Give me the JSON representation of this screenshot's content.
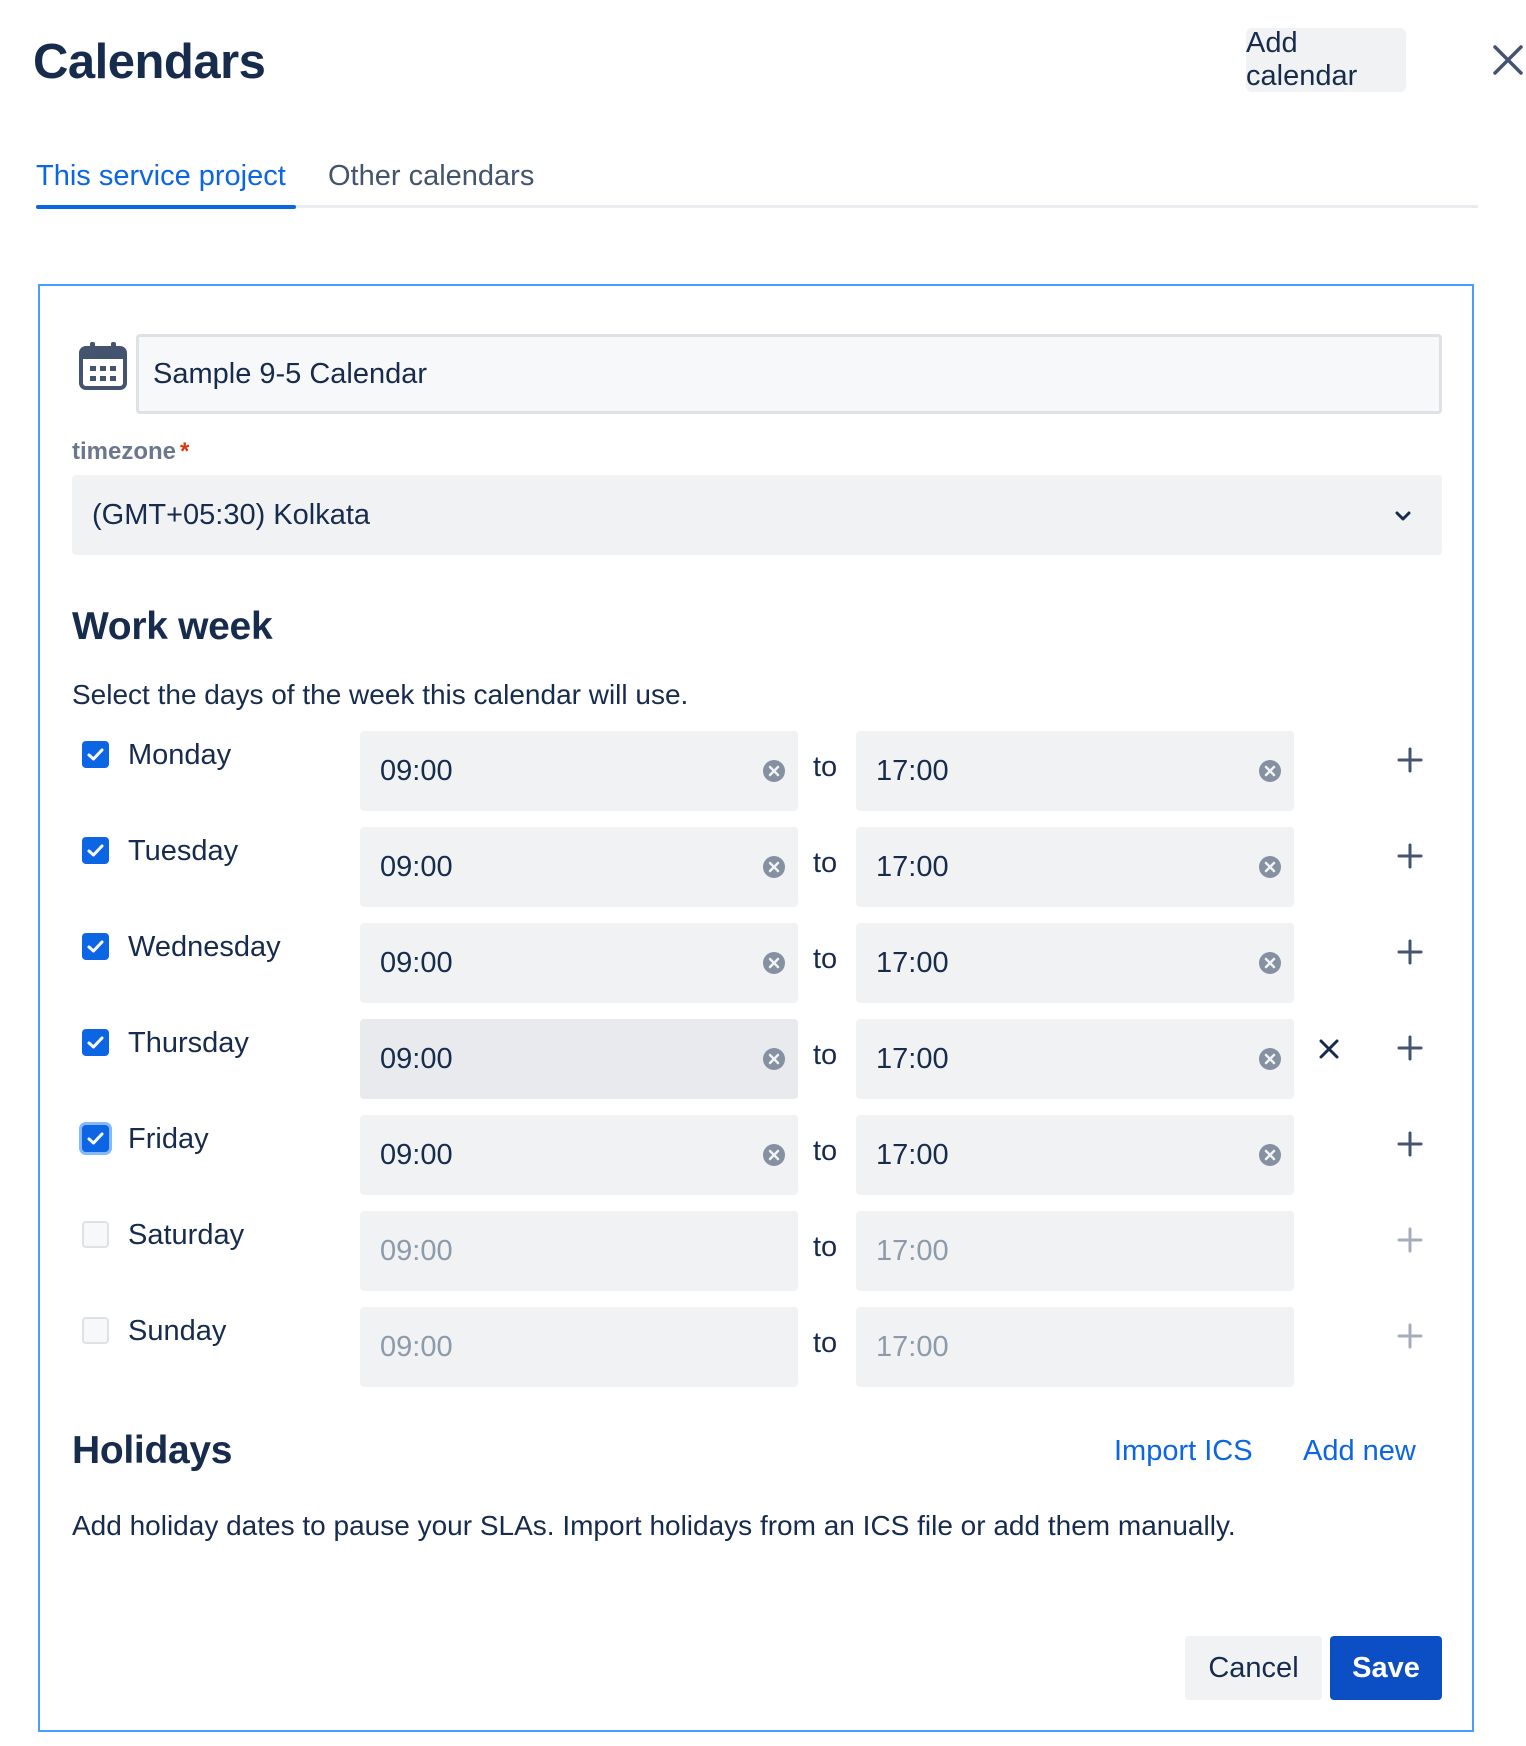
{
  "header": {
    "title": "Calendars",
    "add_calendar_label": "Add calendar",
    "close_icon": "close-icon"
  },
  "tabs": [
    {
      "label": "This service project",
      "active": true
    },
    {
      "label": "Other calendars",
      "active": false
    }
  ],
  "calendar": {
    "icon": "calendar-icon",
    "name": "Sample 9-5 Calendar",
    "timezone_label": "timezone",
    "timezone_required_mark": "*",
    "timezone_value": "(GMT+05:30) Kolkata"
  },
  "work_week": {
    "heading": "Work week",
    "description": "Select the days of the week this calendar will use.",
    "to_label": "to",
    "days": [
      {
        "name": "Monday",
        "checked": true,
        "from": "09:00",
        "to": "17:00"
      },
      {
        "name": "Tuesday",
        "checked": true,
        "from": "09:00",
        "to": "17:00"
      },
      {
        "name": "Wednesday",
        "checked": true,
        "from": "09:00",
        "to": "17:00"
      },
      {
        "name": "Thursday",
        "checked": true,
        "from": "09:00",
        "to": "17:00"
      },
      {
        "name": "Friday",
        "checked": true,
        "from": "09:00",
        "to": "17:00"
      },
      {
        "name": "Saturday",
        "checked": false,
        "from": "09:00",
        "to": "17:00"
      },
      {
        "name": "Sunday",
        "checked": false,
        "from": "09:00",
        "to": "17:00"
      }
    ]
  },
  "holidays": {
    "heading": "Holidays",
    "import_label": "Import ICS",
    "add_new_label": "Add new",
    "description": "Add holiday dates to pause your SLAs. Import holidays from an ICS file or add them manually."
  },
  "footer": {
    "cancel_label": "Cancel",
    "save_label": "Save"
  },
  "colors": {
    "accent": "#0c66e4",
    "primary_button": "#0c4fc4",
    "field_bg": "#f1f2f4",
    "text": "#172b4d"
  }
}
